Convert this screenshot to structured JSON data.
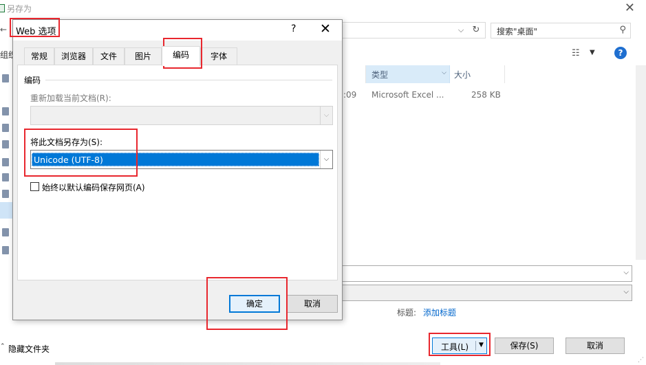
{
  "save_as": {
    "title": "另存为",
    "close": "✕",
    "left_dash": "←",
    "search_placeholder": "搜索\"桌面\"",
    "toolbar_left": "组织",
    "columns": {
      "type": "类型",
      "size": "大小"
    },
    "file_row": {
      "time": ":09",
      "type": "Microsoft Excel ...",
      "size": "258 KB"
    },
    "tags_label": "标题:",
    "tags_link": "添加标题",
    "hide_folders": "隐藏文件夹",
    "tools_button": "工具(L)",
    "save_button": "保存(S)",
    "cancel_button": "取消"
  },
  "web_options": {
    "title": "Web 选项",
    "help": "?",
    "close": "✕",
    "tabs": [
      "常规",
      "浏览器",
      "文件",
      "图片",
      "编码",
      "字体"
    ],
    "active_tab": "编码",
    "group_label": "编码",
    "reload_label": "重新加载当前文档(R):",
    "reload_value": "",
    "saveas_label": "将此文档另存为(S):",
    "saveas_value": "Unicode (UTF-8)",
    "checkbox_label": "始终以默认编码保存网页(A)",
    "checkbox_checked": false,
    "ok_button": "确定",
    "cancel_button": "取消"
  },
  "colors": {
    "highlight": "#e8262d",
    "selection": "#0078d7",
    "link": "#0066cc"
  }
}
